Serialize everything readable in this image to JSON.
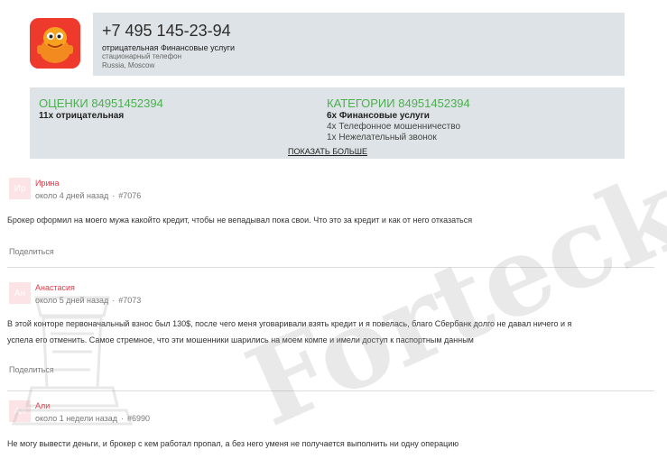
{
  "header": {
    "phone": "+7 495 145-23-94",
    "line1": "отрицательная Финансовые услуги",
    "line2": "стационарный телефон",
    "line3": "Russia, Moscow"
  },
  "stats": {
    "ratings_title": "ОЦЕНКИ 84951452394",
    "ratings_bold": "11x отрицательная",
    "categories_title": "КАТЕГОРИИ 84951452394",
    "categories_bold": "6x Финансовые услуги",
    "categories": [
      "4x Телефонное мошенничество",
      "1x Нежелательный звонок"
    ],
    "show_more": "ПОКАЗАТЬ БОЛЬШЕ"
  },
  "reviews": [
    {
      "initials": "Ир",
      "name": "Ирина",
      "time": "около 4 дней назад",
      "id": "#7076",
      "text": "Брокер оформил на моего мужа какойто кредит, чтобы не вепадывал пока свои. Что это за кредит и как от него отказаться",
      "share": "Поделиться"
    },
    {
      "initials": "Ан",
      "name": "Анастасия",
      "time": "около 5 дней назад",
      "id": "#7073",
      "text_line1": "В этой конторе первоначальный взнос был 130$, после чего меня уговаривали взять кредит и я повелась, благо Сбербанк долго не давал ничего и я",
      "text_line2": "успела его отменить. Самое стремное, что эти мошенники шарились на моем компе и имели доступ к паспортным данным",
      "share": "Поделиться"
    },
    {
      "initials": "Ал",
      "name": "Али",
      "time": "около 1 недели назад",
      "id": "#6990",
      "text": "Не могу вывести деньги, и брокер с кем работал пропал, а без него уменя не получается выполнить ни одну операцию"
    }
  ],
  "watermark": {
    "text": "Forteck"
  },
  "colors": {
    "accent_green": "#4caf50",
    "name_red": "#e53946",
    "panel_bg": "#dde3e6",
    "logo_bg": "#ee3a2c"
  }
}
